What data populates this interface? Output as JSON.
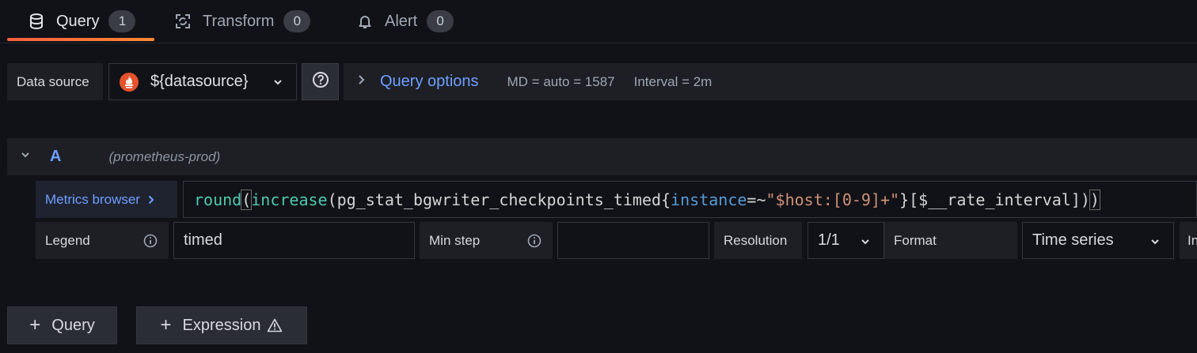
{
  "tabs": [
    {
      "label": "Query",
      "count": "1",
      "icon": "database-icon"
    },
    {
      "label": "Transform",
      "count": "0",
      "icon": "transform-icon"
    },
    {
      "label": "Alert",
      "count": "0",
      "icon": "bell-icon"
    }
  ],
  "datasource": {
    "label": "Data source",
    "value": "${datasource}",
    "icon": "prometheus-icon"
  },
  "query_options": {
    "title": "Query options",
    "md": "MD = auto = 1587",
    "interval": "Interval = 2m"
  },
  "query": {
    "letter": "A",
    "datasource_name": "(prometheus-prod)",
    "metrics_browser_label": "Metrics browser",
    "expression_tokens": [
      {
        "t": "round",
        "c": "fn"
      },
      {
        "t": "(",
        "c": "paren"
      },
      {
        "t": "increase",
        "c": "fn"
      },
      {
        "t": "(pg_stat_bgwriter_checkpoints_timed{",
        "c": "plain"
      },
      {
        "t": "instance",
        "c": "label"
      },
      {
        "t": "=~",
        "c": "plain"
      },
      {
        "t": "\"$host:[0-9]+\"",
        "c": "str"
      },
      {
        "t": "}[$__rate_interval])",
        "c": "plain"
      },
      {
        "t": ")",
        "c": "paren"
      }
    ],
    "legend_label": "Legend",
    "legend_value": "timed",
    "min_step_label": "Min step",
    "min_step_value": "",
    "resolution_label": "Resolution",
    "resolution_value": "1/1",
    "format_label": "Format",
    "format_value": "Time series",
    "instant_label_partial": "In"
  },
  "buttons": {
    "add_query": "Query",
    "add_expression": "Expression"
  },
  "colors": {
    "accent_blue": "#6e9fff",
    "underline_orange": "#f55f3e",
    "prometheus": "#e6522c"
  }
}
